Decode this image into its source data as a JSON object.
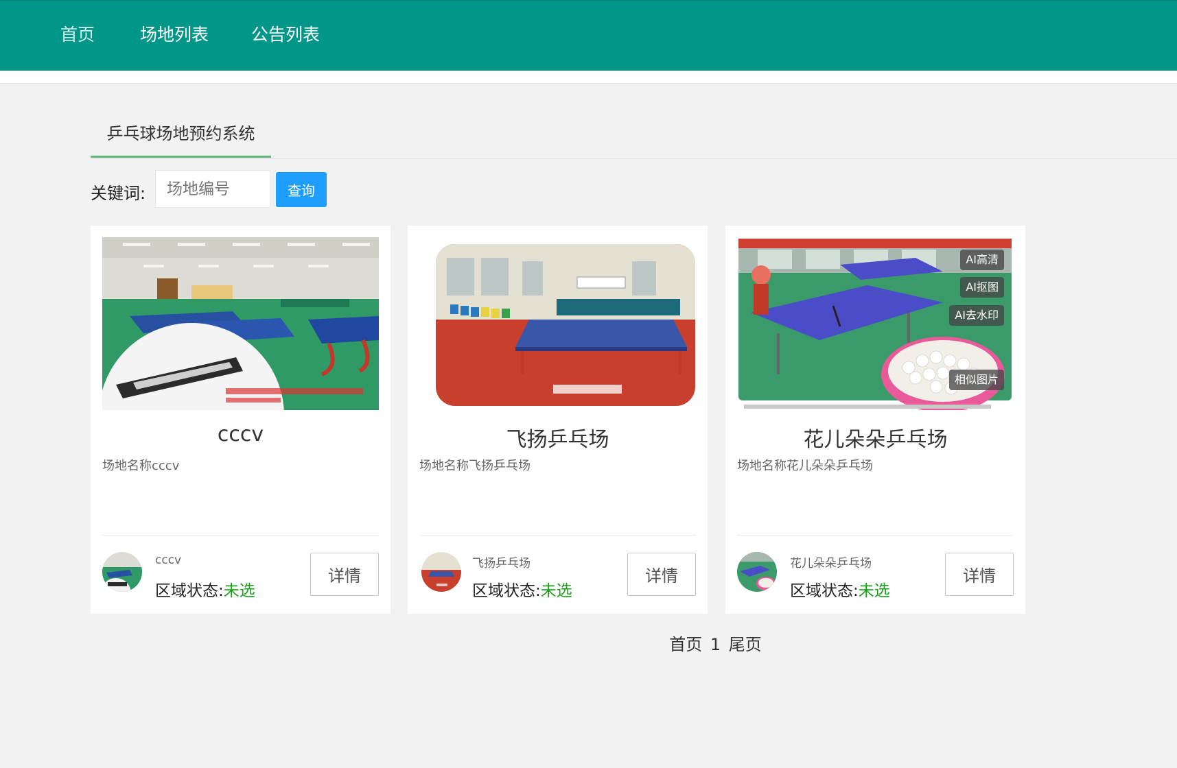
{
  "nav": {
    "items": [
      {
        "label": "首页"
      },
      {
        "label": "场地列表"
      },
      {
        "label": "公告列表"
      }
    ]
  },
  "tab": {
    "title": "乒乓球场地预约系统"
  },
  "search": {
    "label": "关键词:",
    "placeholder": "场地编号",
    "button": "查询"
  },
  "cards": [
    {
      "title": "cccv",
      "desc": "场地名称cccv",
      "footer_name": "cccv",
      "status_label": "区域状态:",
      "status_value": "未选",
      "detail_label": "详情"
    },
    {
      "title": "飞扬乒乓场",
      "desc": "场地名称飞扬乒乓场",
      "footer_name": "飞扬乒乓场",
      "status_label": "区域状态:",
      "status_value": "未选",
      "detail_label": "详情"
    },
    {
      "title": "花儿朵朵乒乓场",
      "desc": "场地名称花儿朵朵乒乓场",
      "footer_name": "花儿朵朵乒乓场",
      "status_label": "区域状态:",
      "status_value": "未选",
      "detail_label": "详情"
    }
  ],
  "image_tools": {
    "hd": "AI高清",
    "cutout": "AI抠图",
    "dewatermark": "AI去水印",
    "similar": "相似图片"
  },
  "pager": {
    "first": "首页",
    "current": "1",
    "last": "尾页"
  },
  "colors": {
    "topbar": "#009688",
    "tab_underline": "#5fb878",
    "search_button": "#1e9fff",
    "status_green": "#1aa11a"
  }
}
